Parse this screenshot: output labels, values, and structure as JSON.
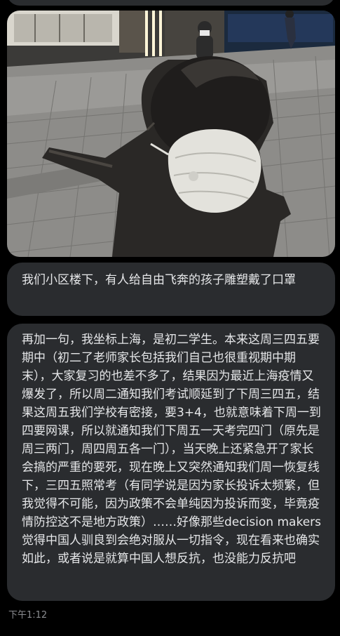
{
  "messages": [
    {
      "type": "image",
      "alt": ""
    },
    {
      "type": "text",
      "text": "我们小区楼下，有人给自由飞奔的孩子雕塑戴了口罩"
    },
    {
      "type": "text",
      "text": "再加一句，我坐标上海，是初二学生。本来这周三四五要期中（初二了老师家长包括我们自己也很重视期中期末），大家复习的也差不多了，结果因为最近上海疫情又爆发了，所以周二通知我们考试顺延到了下周三四五，结果这周五我们学校有密接，要3+4，也就意味着下周一到四要网课，所以就通知我们下周五一天考完四门（原先是周三两门，周四周五各一门），当天晚上还紧急开了家长会搞的严重的要死，现在晚上又突然通知我们周一恢复线下，三四五照常考（有同学说是因为家长投诉太频繁，但我觉得不可能，因为政策不会单纯因为投诉而变，毕竟疫情防控这不是地方政策）……好像那些decision makers 觉得中国人驯良到会绝对服从一切指令，现在看来也确实如此，或者说是就算中国人想反抗，也没能力反抗吧"
    }
  ],
  "timestamp": "下午1:12",
  "colors": {
    "background": "#000000",
    "bubble": "#2a2c2f",
    "text": "#e6e7e9",
    "timestamp": "#8b8d91"
  }
}
